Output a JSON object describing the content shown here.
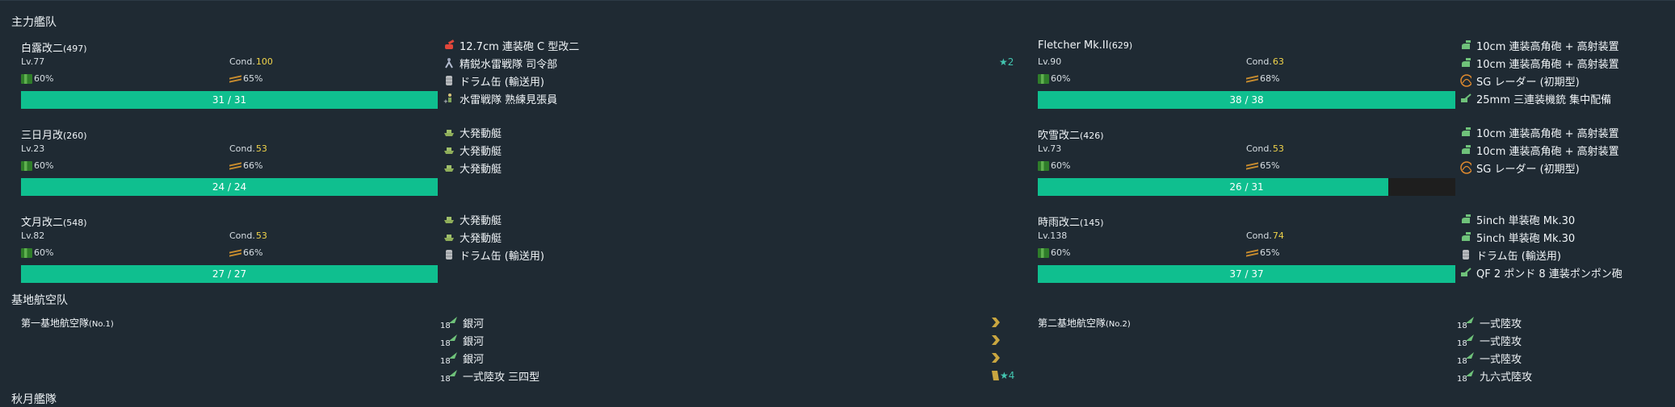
{
  "main_fleet": {
    "title": "主力艦队",
    "ships": [
      {
        "name": "白露改二",
        "id": "(497)",
        "lv": "Lv.77",
        "cond_label": "Cond.",
        "cond": "100",
        "cond_color": "#f1d44a",
        "fuel": "60%",
        "ammo": "65%",
        "hp": "31 / 31",
        "hp_fraction": 1.0,
        "equip": [
          {
            "icon": "gun-red-icon",
            "name": "12.7cm 連装砲 C 型改二"
          },
          {
            "icon": "personnel-icon",
            "name": "精鋭水雷戦隊 司令部",
            "stars": "★2"
          },
          {
            "icon": "drum-icon",
            "name": "ドラム缶 (輸送用)"
          },
          {
            "icon": "lookout-icon",
            "name": "水雷戦隊 熟練見張員"
          }
        ]
      },
      {
        "name": "三日月改",
        "id": "(260)",
        "lv": "Lv.23",
        "cond_label": "Cond.",
        "cond": "53",
        "cond_color": "#f1d44a",
        "fuel": "60%",
        "ammo": "66%",
        "hp": "24 / 24",
        "hp_fraction": 1.0,
        "equip": [
          {
            "icon": "landing-craft-icon",
            "name": "大発動艇"
          },
          {
            "icon": "landing-craft-icon",
            "name": "大発動艇"
          },
          {
            "icon": "landing-craft-icon",
            "name": "大発動艇"
          }
        ]
      },
      {
        "name": "文月改二",
        "id": "(548)",
        "lv": "Lv.82",
        "cond_label": "Cond.",
        "cond": "53",
        "cond_color": "#f1d44a",
        "fuel": "60%",
        "ammo": "66%",
        "hp": "27 / 27",
        "hp_fraction": 1.0,
        "equip": [
          {
            "icon": "landing-craft-icon",
            "name": "大発動艇"
          },
          {
            "icon": "landing-craft-icon",
            "name": "大発動艇"
          },
          {
            "icon": "drum-icon",
            "name": "ドラム缶 (輸送用)"
          }
        ]
      },
      {
        "name": "Fletcher Mk.II",
        "id": "(629)",
        "lv": "Lv.90",
        "cond_label": "Cond.",
        "cond": "63",
        "cond_color": "#f1d44a",
        "fuel": "60%",
        "ammo": "68%",
        "hp": "38 / 38",
        "hp_fraction": 1.0,
        "equip": [
          {
            "icon": "aa-gun-icon",
            "name": "10cm 連装高角砲 + 高射装置"
          },
          {
            "icon": "aa-gun-icon",
            "name": "10cm 連装高角砲 + 高射装置"
          },
          {
            "icon": "radar-icon",
            "name": "SG レーダー (初期型)"
          },
          {
            "icon": "machine-gun-icon",
            "name": "25mm 三連装機銃 集中配備"
          }
        ]
      },
      {
        "name": "吹雪改二",
        "id": "(426)",
        "lv": "Lv.73",
        "cond_label": "Cond.",
        "cond": "53",
        "cond_color": "#f1d44a",
        "fuel": "60%",
        "ammo": "65%",
        "hp": "26 / 31",
        "hp_fraction": 0.839,
        "equip": [
          {
            "icon": "aa-gun-icon",
            "name": "10cm 連装高角砲 + 高射装置"
          },
          {
            "icon": "aa-gun-icon",
            "name": "10cm 連装高角砲 + 高射装置"
          },
          {
            "icon": "radar-icon",
            "name": "SG レーダー (初期型)"
          }
        ]
      },
      {
        "name": "時雨改二",
        "id": "(145)",
        "lv": "Lv.138",
        "cond_label": "Cond.",
        "cond": "74",
        "cond_color": "#f1d44a",
        "fuel": "60%",
        "ammo": "65%",
        "hp": "37 / 37",
        "hp_fraction": 1.0,
        "equip": [
          {
            "icon": "aa-gun-icon",
            "name": "5inch 単装砲 Mk.30"
          },
          {
            "icon": "aa-gun-icon",
            "name": "5inch 単装砲 Mk.30"
          },
          {
            "icon": "drum-icon",
            "name": "ドラム缶 (輸送用)"
          },
          {
            "icon": "machine-gun-icon",
            "name": "QF 2 ポンド 8 連装ポンポン砲"
          }
        ]
      }
    ]
  },
  "air_base": {
    "title": "基地航空队",
    "squadrons": [
      {
        "label": "第一基地航空隊",
        "no": "(No.1)",
        "planes": [
          {
            "count": "18",
            "name": "銀河"
          },
          {
            "count": "18",
            "name": "銀河"
          },
          {
            "count": "18",
            "name": "銀河"
          },
          {
            "count": "18",
            "name": "一式陸攻 三四型",
            "stars": "★4"
          }
        ]
      },
      {
        "label": "第二基地航空隊",
        "no": "(No.2)",
        "planes": [
          {
            "count": "18",
            "name": "一式陸攻"
          },
          {
            "count": "18",
            "name": "一式陸攻"
          },
          {
            "count": "18",
            "name": "一式陸攻"
          },
          {
            "count": "18",
            "name": "九六式陸攻"
          }
        ]
      }
    ]
  },
  "next_section": {
    "title": "秋月艦隊"
  }
}
